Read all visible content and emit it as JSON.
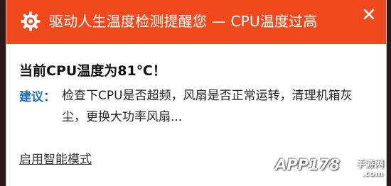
{
  "window": {
    "title": "驱动人生温度检测提醒您 — CPU温度过高",
    "accent_color": "#f0491d",
    "title_icon": "gear-icon",
    "close_icon": "close-icon"
  },
  "content": {
    "headline": "当前CPU温度为81℃！",
    "advice_label": "建议：",
    "advice_text": "检查下CPU是否超频，风扇是否正常运转，清理机箱灰尘，更换大功率风扇...",
    "smart_mode_link": "启用智能模式",
    "advice_color": "#1c6fb8"
  },
  "watermark": {
    "main": "APP178",
    "sub": "手游网",
    "suffix": ".com"
  }
}
